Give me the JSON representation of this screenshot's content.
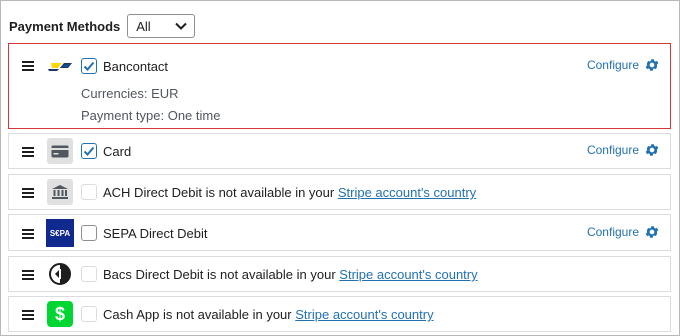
{
  "header": {
    "label": "Payment Methods",
    "filter_value": "All"
  },
  "configure_label": "Configure",
  "methods": [
    {
      "name": "Bancontact",
      "checked": true,
      "currencies": "Currencies: EUR",
      "payment_type": "Payment type: One time"
    },
    {
      "name": "Card",
      "checked": true
    },
    {
      "text": "ACH Direct Debit is not available in your",
      "link": "Stripe account's country"
    },
    {
      "name": "SEPA Direct Debit",
      "checked": false,
      "logo_text": "S€PA"
    },
    {
      "text": "Bacs Direct Debit is not available in your",
      "link": "Stripe account's country"
    },
    {
      "text": "Cash App is not available in your",
      "link": "Stripe account's country"
    }
  ],
  "colors": {
    "accent": "#2271b1",
    "highlight_border": "#d63638"
  }
}
